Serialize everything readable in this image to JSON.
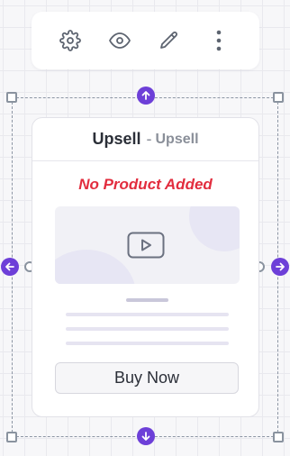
{
  "toolbar": {
    "icons": [
      "gear-icon",
      "eye-icon",
      "pencil-icon",
      "more-vertical-icon"
    ]
  },
  "card": {
    "title": "Upsell",
    "separator": "-",
    "subtitle": "Upsell",
    "empty_message": "No Product Added",
    "media_icon": "play-icon",
    "button_label": "Buy Now"
  },
  "colors": {
    "accent": "#6d3fd8",
    "error": "#e22d3e",
    "handle_border": "#8a939f"
  }
}
